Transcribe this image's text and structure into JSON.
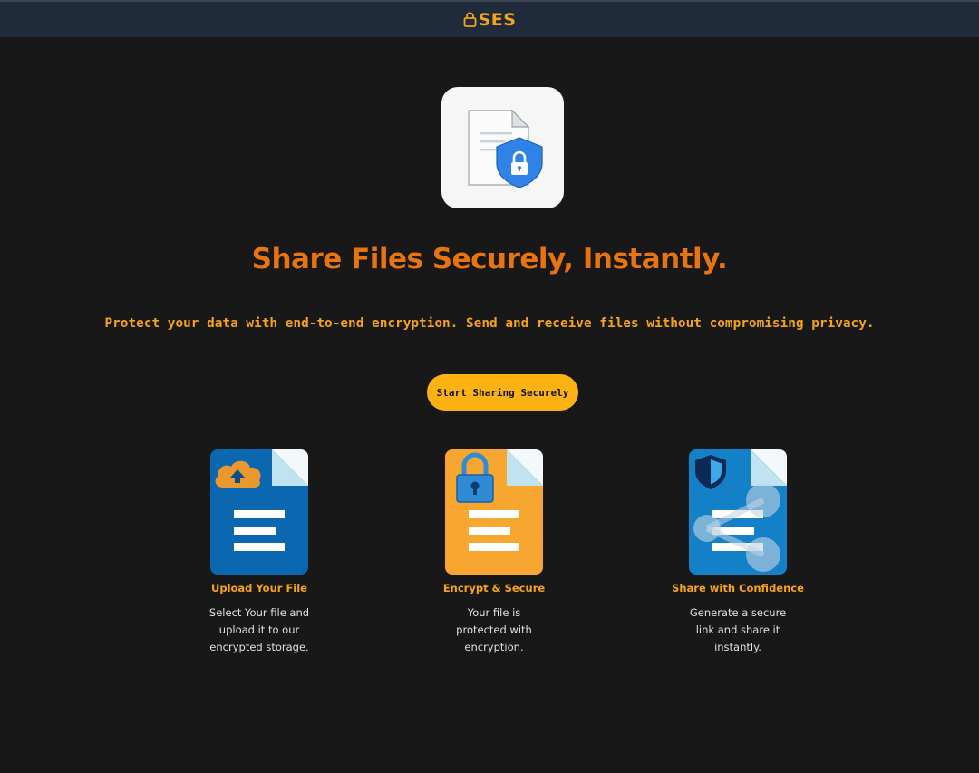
{
  "brand": {
    "name": "SES",
    "color": "#f5a31a",
    "icon": "lock-icon"
  },
  "hero": {
    "icon": "secure-document-icon",
    "title": "Share Files Securely, Instantly.",
    "subtitle": "Protect your data with end-to-end encryption. Send and receive files without compromising privacy.",
    "cta_label": "Start Sharing Securely"
  },
  "features": [
    {
      "icon": "upload-file-icon",
      "title": "Upload Your File",
      "description": "Select Your file and upload it to our encrypted storage."
    },
    {
      "icon": "encrypt-file-icon",
      "title": "Encrypt & Secure",
      "description": "Your file is protected with encryption."
    },
    {
      "icon": "share-file-icon",
      "title": "Share with Confidence",
      "description": "Generate a secure link and share it instantly."
    }
  ],
  "colors": {
    "background": "#181818",
    "header": "#1f2a3a",
    "title": "#e8740f",
    "accent": "#f5a31a",
    "button": "#fbb212"
  }
}
